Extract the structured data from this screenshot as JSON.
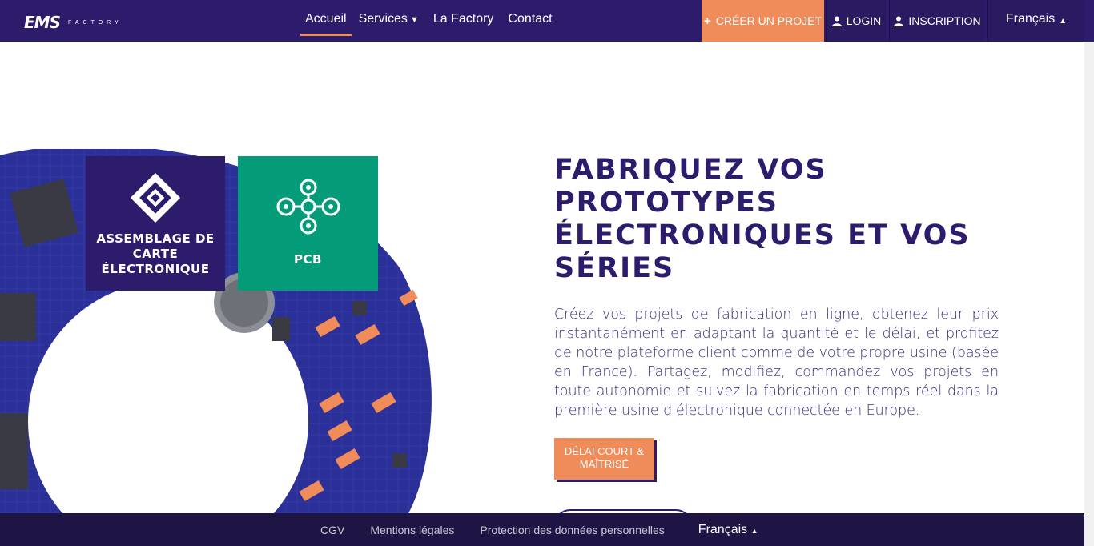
{
  "header": {
    "logo_mark": "EMS",
    "logo_sub": "FACTORY",
    "nav": [
      {
        "label": "Accueil",
        "active": true
      },
      {
        "label": "Services",
        "has_dropdown": true
      },
      {
        "label": "La Factory"
      },
      {
        "label": "Contact"
      }
    ],
    "create_label": "CRÉER UN PROJET",
    "login_label": "LOGIN",
    "signup_label": "INSCRIPTION",
    "language": "Français"
  },
  "tiles": {
    "assembly_label": "ASSEMBLAGE DE CARTE ÉLECTRONIQUE",
    "pcb_label": "PCB"
  },
  "hero": {
    "title": "FABRIQUEZ VOS PROTOTYPES ÉLECTRONIQUES ET VOS SÉRIES",
    "text": "Créez vos projets de fabrication en ligne, obtenez leur prix instantanément en adaptant la quantité et le délai, et profitez de notre plateforme client comme de votre propre usine (basée en France). Partagez, modifiez, commandez vos projets en toute autonomie et suivez la fabrication en temps réel dans la première usine d'électronique connectée en Europe.",
    "badge_label": "DÉLAI COURT & MAÎTRISÉ"
  },
  "footer": {
    "links": [
      "CGV",
      "Mentions légales",
      "Protection des données personnelles"
    ],
    "language": "Français"
  },
  "colors": {
    "brand": "#2d1b6b",
    "accent": "#f08b5a",
    "pcb": "#049c78",
    "footer": "#1e1544"
  }
}
